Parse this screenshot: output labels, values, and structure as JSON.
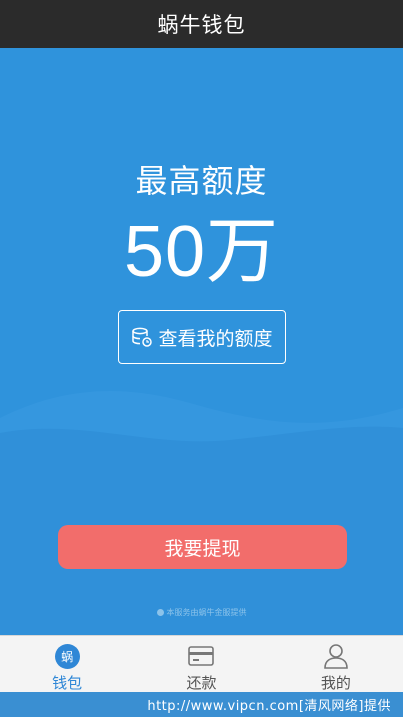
{
  "header": {
    "title": "蜗牛钱包"
  },
  "hero": {
    "quota_label": "最高额度",
    "quota_amount": "50万",
    "view_quota_label": "查看我的额度"
  },
  "actions": {
    "withdraw_label": "我要提现"
  },
  "footnote": {
    "text": "本服务由蜗牛金服提供"
  },
  "tabbar": {
    "items": [
      {
        "label": "钱包",
        "icon": "snail-logo-icon",
        "logo_char": "蜗",
        "active": true
      },
      {
        "label": "还款",
        "icon": "card-icon",
        "active": false
      },
      {
        "label": "我的",
        "icon": "user-icon",
        "active": false
      }
    ]
  },
  "watermark": {
    "text": "http://www.vipcn.com[清风网络]提供"
  },
  "colors": {
    "primary_bg": "#2f93dc",
    "title_bar": "#2b2b2b",
    "withdraw_button": "#f26d6b",
    "tab_active": "#2f87d6"
  }
}
